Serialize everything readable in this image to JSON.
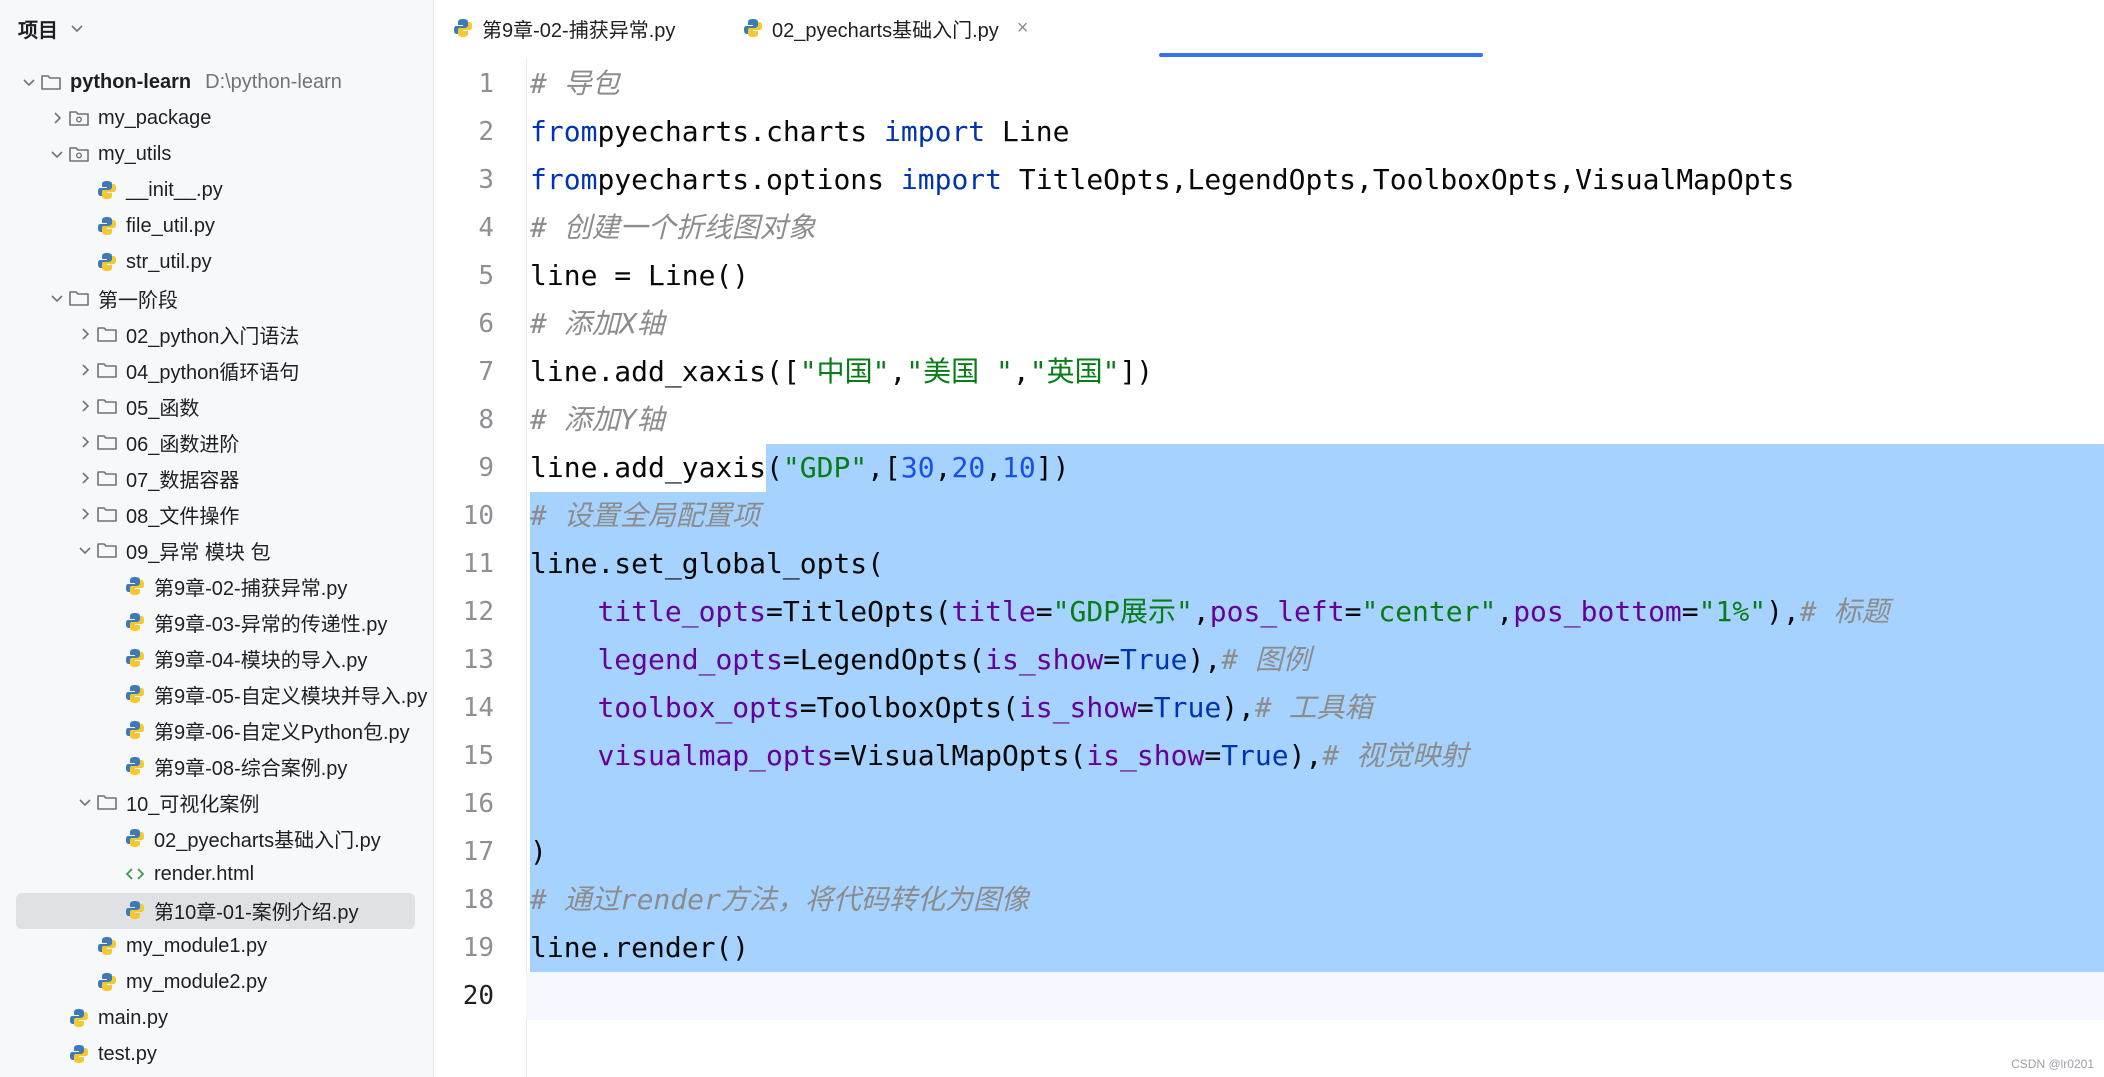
{
  "sidebar": {
    "title": "项目",
    "tree": [
      {
        "label": "python-learn",
        "hint": "D:\\python-learn",
        "icon": "folder",
        "arrow": "down",
        "indent": 0,
        "bold": true
      },
      {
        "label": "my_package",
        "icon": "package-folder",
        "arrow": "right",
        "indent": 1
      },
      {
        "label": "my_utils",
        "icon": "package-folder",
        "arrow": "down",
        "indent": 1
      },
      {
        "label": "__init__.py",
        "icon": "python",
        "arrow": "",
        "indent": 2
      },
      {
        "label": "file_util.py",
        "icon": "python",
        "arrow": "",
        "indent": 2
      },
      {
        "label": "str_util.py",
        "icon": "python",
        "arrow": "",
        "indent": 2
      },
      {
        "label": "第一阶段",
        "icon": "folder",
        "arrow": "down",
        "indent": 1
      },
      {
        "label": "02_python入门语法",
        "icon": "folder",
        "arrow": "right",
        "indent": 2
      },
      {
        "label": "04_python循环语句",
        "icon": "folder",
        "arrow": "right",
        "indent": 2
      },
      {
        "label": "05_函数",
        "icon": "folder",
        "arrow": "right",
        "indent": 2
      },
      {
        "label": "06_函数进阶",
        "icon": "folder",
        "arrow": "right",
        "indent": 2
      },
      {
        "label": "07_数据容器",
        "icon": "folder",
        "arrow": "right",
        "indent": 2
      },
      {
        "label": "08_文件操作",
        "icon": "folder",
        "arrow": "right",
        "indent": 2
      },
      {
        "label": "09_异常 模块 包",
        "icon": "folder",
        "arrow": "down",
        "indent": 2
      },
      {
        "label": "第9章-02-捕获异常.py",
        "icon": "python",
        "arrow": "",
        "indent": 3
      },
      {
        "label": "第9章-03-异常的传递性.py",
        "icon": "python",
        "arrow": "",
        "indent": 3
      },
      {
        "label": "第9章-04-模块的导入.py",
        "icon": "python",
        "arrow": "",
        "indent": 3
      },
      {
        "label": "第9章-05-自定义模块并导入.py",
        "icon": "python",
        "arrow": "",
        "indent": 3
      },
      {
        "label": "第9章-06-自定义Python包.py",
        "icon": "python",
        "arrow": "",
        "indent": 3
      },
      {
        "label": "第9章-08-综合案例.py",
        "icon": "python",
        "arrow": "",
        "indent": 3
      },
      {
        "label": "10_可视化案例",
        "icon": "folder",
        "arrow": "down",
        "indent": 2
      },
      {
        "label": "02_pyecharts基础入门.py",
        "icon": "python",
        "arrow": "",
        "indent": 3
      },
      {
        "label": "render.html",
        "icon": "html",
        "arrow": "",
        "indent": 3
      },
      {
        "label": "第10章-01-案例介绍.py",
        "icon": "python",
        "arrow": "",
        "indent": 3,
        "selected": true
      },
      {
        "label": "my_module1.py",
        "icon": "python",
        "arrow": "",
        "indent": 2
      },
      {
        "label": "my_module2.py",
        "icon": "python",
        "arrow": "",
        "indent": 2
      },
      {
        "label": "main.py",
        "icon": "python",
        "arrow": "",
        "indent": 1
      },
      {
        "label": "test.py",
        "icon": "python",
        "arrow": "",
        "indent": 1
      }
    ]
  },
  "tabs": [
    {
      "label": "第9章-02-捕获异常.py",
      "active": false
    },
    {
      "label": "02_pyecharts基础入门.py",
      "active": true,
      "close": "×"
    }
  ],
  "editor": {
    "lines": [
      {
        "n": "1",
        "t": [
          [
            "cm",
            "# 导包"
          ]
        ]
      },
      {
        "n": "2",
        "t": [
          [
            "kw",
            "from"
          ],
          [
            "",
            "pyecharts.charts "
          ],
          [
            "kw",
            "import"
          ],
          [
            "",
            " Line"
          ]
        ]
      },
      {
        "n": "3",
        "t": [
          [
            "kw",
            "from"
          ],
          [
            "",
            "pyecharts.options "
          ],
          [
            "kw",
            "import"
          ],
          [
            "",
            " TitleOpts,LegendOpts,ToolboxOpts,VisualMapOpts"
          ]
        ]
      },
      {
        "n": "4",
        "t": [
          [
            "cm",
            "# 创建一个折线图对象"
          ]
        ]
      },
      {
        "n": "5",
        "t": [
          [
            "",
            "line = Line()"
          ]
        ]
      },
      {
        "n": "6",
        "t": [
          [
            "cm",
            "# 添加X轴"
          ]
        ]
      },
      {
        "n": "7",
        "t": [
          [
            "",
            "line.add_xaxis(["
          ],
          [
            "str",
            "\"中国\""
          ],
          [
            "",
            ","
          ],
          [
            "str",
            "\"美国 \""
          ],
          [
            "",
            ","
          ],
          [
            "str",
            "\"英国\""
          ],
          [
            "",
            "])"
          ]
        ]
      },
      {
        "n": "8",
        "t": [
          [
            "cm",
            "# 添加Y轴"
          ]
        ]
      },
      {
        "n": "9",
        "t": [
          [
            "",
            "line.add_yaxis("
          ],
          [
            "str",
            "\"GDP\""
          ],
          [
            "",
            ",["
          ],
          [
            "num",
            "30"
          ],
          [
            "",
            ","
          ],
          [
            "num",
            "20"
          ],
          [
            "",
            ","
          ],
          [
            "num",
            "10"
          ],
          [
            "",
            "])"
          ]
        ]
      },
      {
        "n": "10",
        "t": [
          [
            "cm",
            "# 设置全局配置项"
          ]
        ]
      },
      {
        "n": "11",
        "t": [
          [
            "",
            "line.set_global_opts("
          ]
        ]
      },
      {
        "n": "12",
        "t": [
          [
            "",
            "    "
          ],
          [
            "param",
            "title_opts"
          ],
          [
            "",
            "=TitleOpts("
          ],
          [
            "param",
            "title"
          ],
          [
            "",
            "="
          ],
          [
            "str",
            "\"GDP展示\""
          ],
          [
            "",
            ","
          ],
          [
            "param",
            "pos_left"
          ],
          [
            "",
            "="
          ],
          [
            "str",
            "\"center\""
          ],
          [
            "",
            ","
          ],
          [
            "param",
            "pos_bottom"
          ],
          [
            "",
            "="
          ],
          [
            "str",
            "\"1%\""
          ],
          [
            "",
            "),"
          ],
          [
            "cm",
            "# 标题"
          ]
        ]
      },
      {
        "n": "13",
        "t": [
          [
            "",
            "    "
          ],
          [
            "param",
            "legend_opts"
          ],
          [
            "",
            "=LegendOpts("
          ],
          [
            "param",
            "is_show"
          ],
          [
            "",
            "="
          ],
          [
            "bool",
            "True"
          ],
          [
            "",
            "),"
          ],
          [
            "cm",
            "# 图例"
          ]
        ]
      },
      {
        "n": "14",
        "t": [
          [
            "",
            "    "
          ],
          [
            "param",
            "toolbox_opts"
          ],
          [
            "",
            "=ToolboxOpts("
          ],
          [
            "param",
            "is_show"
          ],
          [
            "",
            "="
          ],
          [
            "bool",
            "True"
          ],
          [
            "",
            "),"
          ],
          [
            "cm",
            "# 工具箱"
          ]
        ]
      },
      {
        "n": "15",
        "t": [
          [
            "",
            "    "
          ],
          [
            "param",
            "visualmap_opts"
          ],
          [
            "",
            "=VisualMapOpts("
          ],
          [
            "param",
            "is_show"
          ],
          [
            "",
            "="
          ],
          [
            "bool",
            "True"
          ],
          [
            "",
            "),"
          ],
          [
            "cm",
            "# 视觉映射"
          ]
        ]
      },
      {
        "n": "16",
        "t": []
      },
      {
        "n": "17",
        "t": [
          [
            "",
            ")"
          ]
        ]
      },
      {
        "n": "18",
        "t": [
          [
            "cm",
            "# 通过render方法，将代码转化为图像"
          ]
        ]
      },
      {
        "n": "19",
        "t": [
          [
            "",
            "line.render()"
          ]
        ]
      },
      {
        "n": "20",
        "t": []
      }
    ]
  },
  "watermark": "CSDN @lr0201"
}
